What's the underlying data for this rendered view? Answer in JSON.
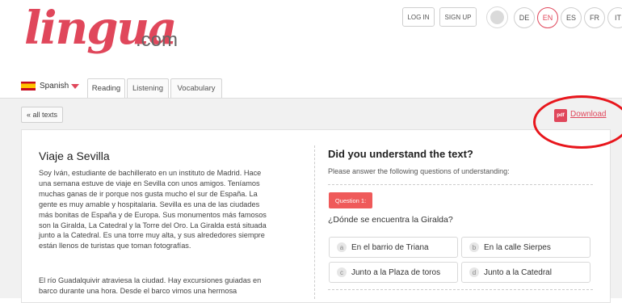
{
  "header": {
    "logo_main": "lingua",
    "logo_suffix": ".com",
    "login_label": "LOG IN",
    "signup_label": "SIGN UP",
    "languages": [
      "DE",
      "EN",
      "ES",
      "FR",
      "IT"
    ],
    "active_language": "EN"
  },
  "tabs": {
    "language_label": "Spanish",
    "reading_label": "Reading",
    "listening_label": "Listening",
    "vocabulary_label": "Vocabulary"
  },
  "toolbar": {
    "all_texts_label": "« all texts",
    "pdf_label": "pdf",
    "download_label": "Download"
  },
  "text": {
    "title": "Viaje a Sevilla",
    "lines_p1": [
      "Soy Iván, estudiante de bachillerato en un instituto de Madrid. Hace",
      "una semana estuve de viaje en Sevilla con unos amigos. Teníamos",
      "muchas ganas de ir porque nos gusta mucho el sur de España. La",
      "gente es muy amable y hospitalaria. Sevilla es una de las ciudades",
      "más bonitas de España y de Europa. Sus monumentos más famosos",
      "son la Giralda, La Catedral y la Torre del Oro. La Giralda está situada",
      "junto a la Catedral. Es una torre muy alta, y sus alrededores siempre",
      "están llenos de turistas que toman fotografías."
    ],
    "lines_p2": [
      "El río Guadalquivir atraviesa la ciudad. Hay excursiones guiadas en",
      "barco durante una hora. Desde el barco vimos una hermosa"
    ]
  },
  "quiz": {
    "heading": "Did you understand the text?",
    "subheading": "Please answer the following questions of understanding:",
    "question_badge": "Question 1:",
    "question": "¿Dónde se encuentra la Giralda?",
    "options": [
      {
        "letter": "a",
        "text": "En el barrio de Triana"
      },
      {
        "letter": "b",
        "text": "En la calle Sierpes"
      },
      {
        "letter": "c",
        "text": "Junto a la Plaza de toros"
      },
      {
        "letter": "d",
        "text": "Junto a la Catedral"
      }
    ]
  },
  "colors": {
    "brand": "#e0475b",
    "annotation_circle": "#e8161c"
  }
}
